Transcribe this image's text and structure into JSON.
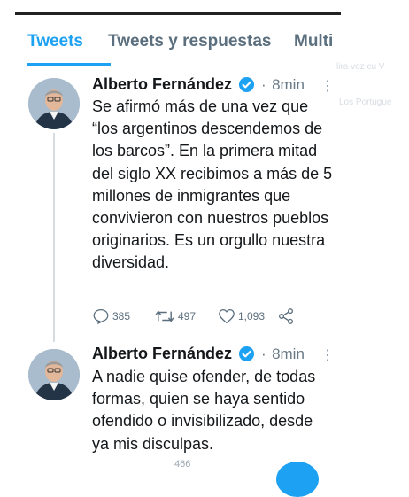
{
  "tabs": [
    {
      "label": "Tweets",
      "active": true
    },
    {
      "label": "Tweets y respuestas",
      "active": false
    },
    {
      "label": "Multi",
      "active": false
    }
  ],
  "ghost_text": [
    "lira voz cu V",
    "Los Portugue"
  ],
  "accent_color": "#1da1f2",
  "tweets": [
    {
      "author": "Alberto Fernández",
      "verified": true,
      "separator": "·",
      "time": "8min",
      "text": "Se afirmó más de una vez que “los argentinos descendemos de los barcos”. En la primera mitad del siglo XX recibimos a más de 5 millones de inmigrantes que convivieron con nuestros pueblos originarios. Es un orgullo nuestra diversidad.",
      "replies": "385",
      "retweets": "497",
      "likes": "1,093"
    },
    {
      "author": "Alberto Fernández",
      "verified": true,
      "separator": "·",
      "time": "8min",
      "text": "A nadie quise ofender, de todas formas, quien se haya sentido ofendido o invisibilizado, desde ya mis disculpas.",
      "partial_count": "466"
    }
  ]
}
